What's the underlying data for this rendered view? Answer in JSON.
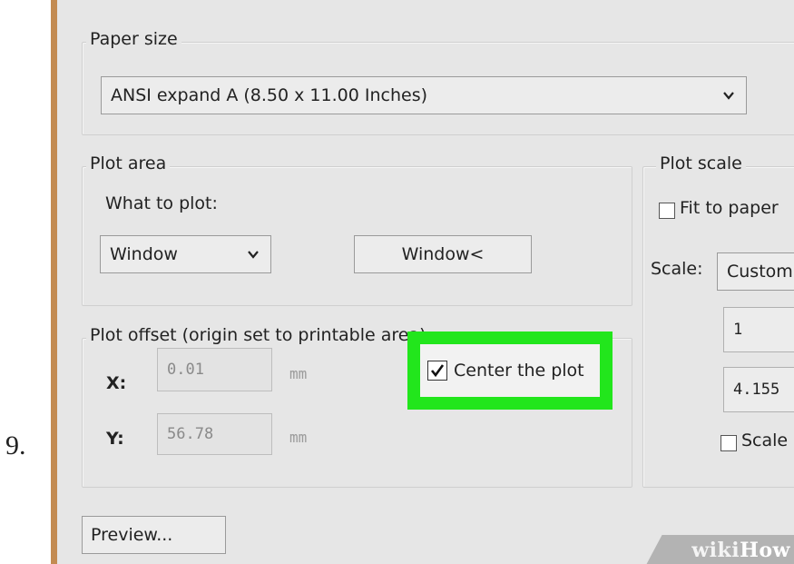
{
  "step_number": "9.",
  "colors": {
    "highlight": "#22e61c",
    "rail": "#c38b52",
    "panel_bg": "#e6e6e6"
  },
  "paper_size": {
    "legend": "Paper size",
    "selected": "ANSI expand A (8.50 x 11.00 Inches)",
    "dropdown_icon": "chevron-down-icon"
  },
  "plot_area": {
    "legend": "Plot area",
    "what_to_plot_label": "What to plot:",
    "selected": "Window",
    "window_button": "Window<"
  },
  "plot_offset": {
    "legend": "Plot offset (origin set to printable area)",
    "x_label": "X:",
    "x_value": "0.01",
    "x_unit": "mm",
    "y_label": "Y:",
    "y_value": "56.78",
    "y_unit": "mm",
    "center_plot_label": "Center the plot",
    "center_plot_checked": true
  },
  "plot_scale": {
    "legend": "Plot scale",
    "fit_to_paper_label": "Fit to paper",
    "fit_to_paper_checked": false,
    "scale_label": "Scale:",
    "scale_selected": "Custom",
    "value_1": "1",
    "value_2": "4.155",
    "scale_lineweights_label": "Scale",
    "scale_lineweights_checked": false
  },
  "preview_button": "Preview...",
  "watermark": {
    "prefix": "wiki",
    "suffix": "How"
  }
}
